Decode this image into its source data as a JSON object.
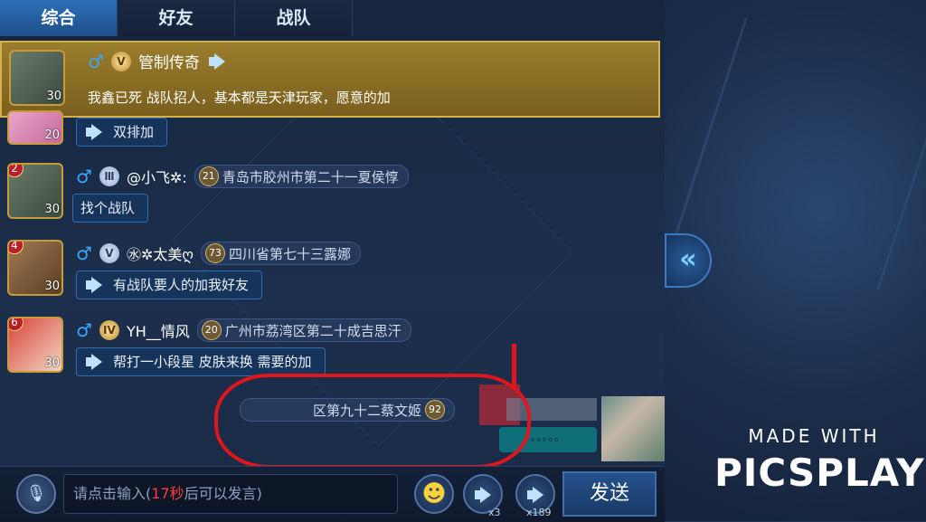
{
  "tabs": [
    {
      "label": "综合",
      "active": true
    },
    {
      "label": "好友",
      "active": false
    },
    {
      "label": "战队",
      "active": false
    }
  ],
  "pinned": {
    "name": "管制传奇",
    "level": "30",
    "text": "我鑫已死  战队招人，基本都是天津玩家，愿意的加",
    "vip_badge": "V"
  },
  "messages": [
    {
      "rank": "",
      "level": "20",
      "name": "",
      "badge": "",
      "location_level": "",
      "location": "",
      "text": "双排加"
    },
    {
      "rank": "2",
      "level": "30",
      "name": "@小飞✲:",
      "badge": "Ⅲ",
      "location_level": "21",
      "location": "青岛市胶州市第二十一夏侯惇",
      "text": "找个战队"
    },
    {
      "rank": "4",
      "level": "30",
      "name": "㊌✲太美ღ",
      "badge": "V",
      "location_level": "73",
      "location": "四川省第七十三露娜",
      "text": "有战队要人的加我好友"
    },
    {
      "rank": "6",
      "level": "30",
      "name": "YH__情风",
      "badge": "IV",
      "location_level": "20",
      "location": "广州市荔湾区第二十成吉思汗",
      "text": "帮打一小段星 皮肤来换 需要的加"
    }
  ],
  "redacted": {
    "location": "区第九十二蔡文姬",
    "location_level": "92",
    "dots": "。。。。。"
  },
  "input": {
    "prefix": "请点击输入(",
    "seconds": "17秒",
    "suffix": "后可以发言)"
  },
  "horn_small_count": "x3",
  "horn_large_count": "x189",
  "send_label": "发送",
  "watermark": {
    "line1": "MADE WITH",
    "line2": "PICSPLAY"
  },
  "colors": {
    "accent": "#2d6fb8",
    "highlight": "#9a7d2c",
    "annotation": "#e0161c"
  }
}
